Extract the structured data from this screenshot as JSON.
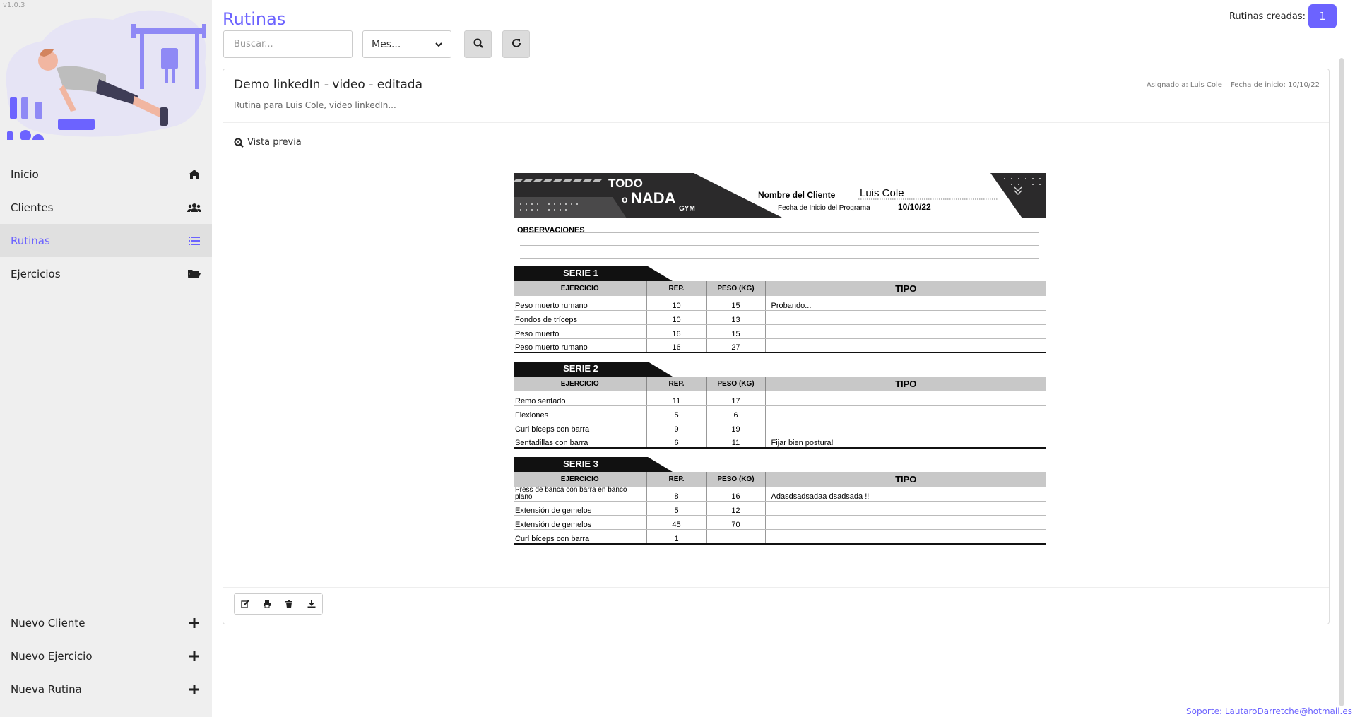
{
  "app": {
    "version": "v1.0.3"
  },
  "sidebar": {
    "items": [
      {
        "label": "Inicio",
        "icon": "home-icon"
      },
      {
        "label": "Clientes",
        "icon": "users-icon"
      },
      {
        "label": "Rutinas",
        "icon": "list-icon",
        "active": true
      },
      {
        "label": "Ejercicios",
        "icon": "folder-open-icon"
      }
    ],
    "bottom_items": [
      {
        "label": "Nuevo Cliente",
        "icon": "plus-icon"
      },
      {
        "label": "Nuevo Ejercicio",
        "icon": "plus-icon"
      },
      {
        "label": "Nueva Rutina",
        "icon": "plus-icon"
      }
    ]
  },
  "header": {
    "title": "Rutinas",
    "search_placeholder": "Buscar...",
    "month_select": "Mes...",
    "counter_label": "Rutinas creadas:",
    "counter_value": "1"
  },
  "card": {
    "title": "Demo linkedIn - video - editada",
    "subtitle": "Rutina para Luis Cole, video linkedIn...",
    "assigned": "Asignado a: Luis Cole",
    "start": "Fecha de inicio: 10/10/22",
    "preview_label": "Vista previa"
  },
  "sheet": {
    "brand_top": "TODO",
    "brand_mid": "NADA",
    "brand_o": "o",
    "brand_gym": "GYM",
    "client_label": "Nombre del Cliente",
    "client_value": "Luis Cole",
    "start_label": "Fecha de Inicio del Programa",
    "start_value": "10/10/22",
    "obs_label": "OBSERVACIONES",
    "col_exercise": "EJERCICIO",
    "col_reps": "REP.",
    "col_weight": "PESO (KG)",
    "col_type": "TIPO",
    "series": [
      {
        "name": "SERIE 1",
        "rows": [
          {
            "exercise": "Peso muerto rumano",
            "reps": "10",
            "weight": "15",
            "type": "Probando..."
          },
          {
            "exercise": "Fondos de tríceps",
            "reps": "10",
            "weight": "13",
            "type": ""
          },
          {
            "exercise": "Peso muerto",
            "reps": "16",
            "weight": "15",
            "type": ""
          },
          {
            "exercise": "Peso muerto rumano",
            "reps": "16",
            "weight": "27",
            "type": ""
          }
        ]
      },
      {
        "name": "SERIE 2",
        "rows": [
          {
            "exercise": "Remo sentado",
            "reps": "11",
            "weight": "17",
            "type": ""
          },
          {
            "exercise": "Flexiones",
            "reps": "5",
            "weight": "6",
            "type": ""
          },
          {
            "exercise": "Curl bíceps con barra",
            "reps": "9",
            "weight": "19",
            "type": ""
          },
          {
            "exercise": "Sentadillas con barra",
            "reps": "6",
            "weight": "11",
            "type": "Fijar bien postura!"
          }
        ]
      },
      {
        "name": "SERIE 3",
        "rows": [
          {
            "exercise": "Press de banca con barra en banco plano",
            "reps": "8",
            "weight": "16",
            "type": "Adasdsadsadaa dsadsada !!"
          },
          {
            "exercise": "Extensión de gemelos",
            "reps": "5",
            "weight": "12",
            "type": ""
          },
          {
            "exercise": "Extensión de gemelos",
            "reps": "45",
            "weight": "70",
            "type": ""
          },
          {
            "exercise": "Curl bíceps con barra",
            "reps": "1",
            "weight": "",
            "type": ""
          }
        ]
      }
    ]
  },
  "actions": [
    "edit-icon",
    "print-icon",
    "trash-icon",
    "download-icon"
  ],
  "footer": {
    "support": "Soporte: LautaroDarretche@hotmail.es"
  },
  "colors": {
    "accent": "#6c63ff",
    "sidebar_bg": "#efefef"
  }
}
